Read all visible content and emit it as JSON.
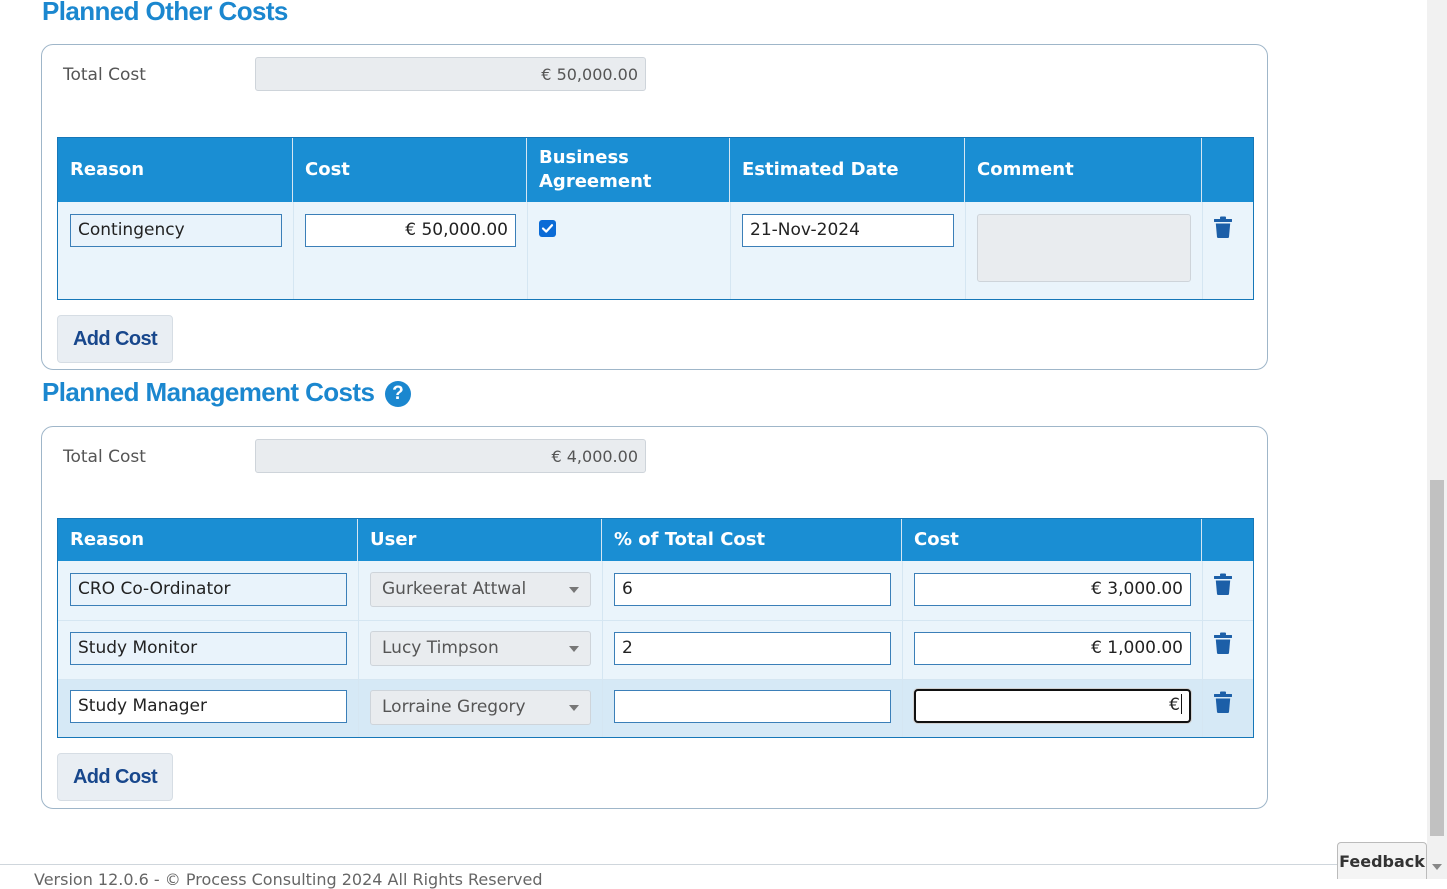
{
  "other_costs": {
    "title": "Planned Other Costs",
    "total_label": "Total Cost",
    "total_value": "€ 50,000.00",
    "columns": [
      "Reason",
      "Cost",
      "Business Agreement",
      "Estimated Date",
      "Comment"
    ],
    "rows": [
      {
        "reason": "Contingency",
        "cost": "€ 50,000.00",
        "business_agreement": true,
        "estimated_date": "21-Nov-2024",
        "comment": ""
      }
    ],
    "add_button": "Add Cost"
  },
  "management_costs": {
    "title": "Planned Management Costs",
    "help_glyph": "?",
    "total_label": "Total Cost",
    "total_value": "€ 4,000.00",
    "columns": [
      "Reason",
      "User",
      "% of Total Cost",
      "Cost"
    ],
    "rows": [
      {
        "reason": "CRO Co-Ordinator",
        "user": "Gurkeerat Attwal",
        "percent": "6",
        "cost": "€ 3,000.00"
      },
      {
        "reason": "Study Monitor",
        "user": "Lucy Timpson",
        "percent": "2",
        "cost": "€ 1,000.00"
      },
      {
        "reason": "Study Manager",
        "user": "Lorraine Gregory",
        "percent": "",
        "cost": "€"
      }
    ],
    "add_button": "Add Cost"
  },
  "footer": {
    "text": "Version 12.0.6 - © Process Consulting 2024 All Rights Reserved"
  },
  "feedback_label": "Feedback",
  "icons": {
    "delete": "trash-icon",
    "help": "question-circle-icon",
    "dropdown": "chevron-down-icon"
  },
  "colors": {
    "header_blue": "#1a8ed3",
    "title_blue": "#1b87cf",
    "button_text": "#18478c",
    "trash_blue": "#1c5fa8"
  }
}
